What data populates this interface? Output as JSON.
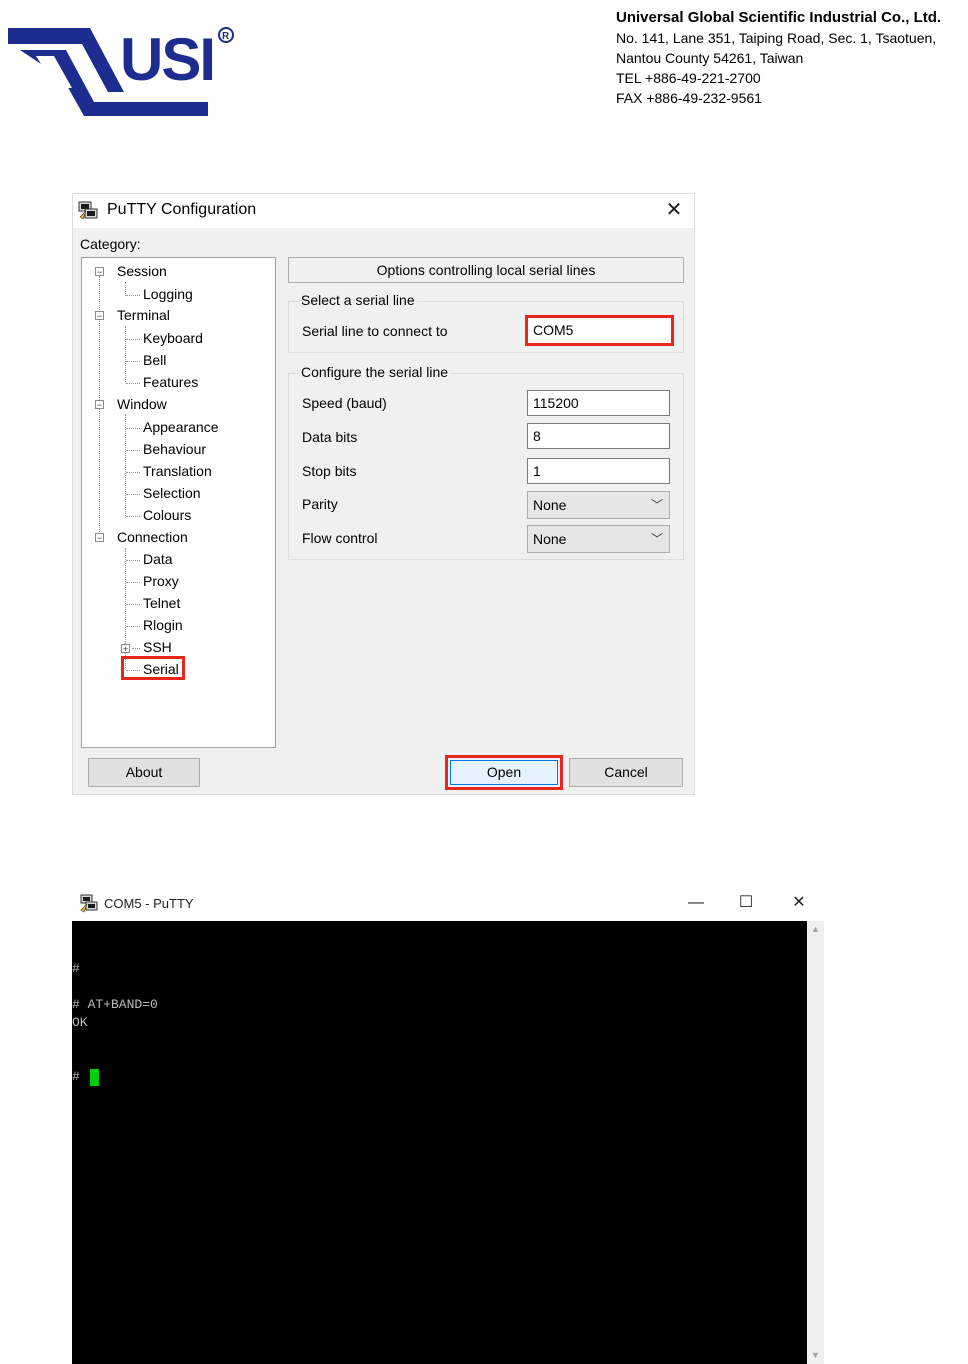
{
  "header": {
    "logo_text": "USI",
    "company_name": "Universal Global Scientific Industrial Co., Ltd.",
    "address_line1": "No. 141, Lane 351, Taiping Road, Sec. 1, Tsaotuen,",
    "address_line2": "Nantou County 54261, Taiwan",
    "tel": "TEL  +886-49-221-2700",
    "fax": "FAX +886-49-232-9561"
  },
  "config_dialog": {
    "title": "PuTTY Configuration",
    "category_label": "Category:",
    "tree": {
      "session": "Session",
      "logging": "Logging",
      "terminal": "Terminal",
      "keyboard": "Keyboard",
      "bell": "Bell",
      "features": "Features",
      "window": "Window",
      "appearance": "Appearance",
      "behaviour": "Behaviour",
      "translation": "Translation",
      "selection": "Selection",
      "colours": "Colours",
      "connection": "Connection",
      "data": "Data",
      "proxy": "Proxy",
      "telnet": "Telnet",
      "rlogin": "Rlogin",
      "ssh": "SSH",
      "serial": "Serial"
    },
    "panel_header": "Options controlling local serial lines",
    "select_group": {
      "label": "Select a serial line",
      "serial_line_label": "Serial line to connect to",
      "serial_line_value": "COM5"
    },
    "config_group": {
      "label": "Configure the serial line",
      "speed_label": "Speed (baud)",
      "speed_value": "115200",
      "data_bits_label": "Data bits",
      "data_bits_value": "8",
      "stop_bits_label": "Stop bits",
      "stop_bits_value": "1",
      "parity_label": "Parity",
      "parity_value": "None",
      "flow_label": "Flow control",
      "flow_value": "None"
    },
    "buttons": {
      "about": "About",
      "open": "Open",
      "cancel": "Cancel"
    },
    "highlight_color": "#e8261d"
  },
  "terminal_window": {
    "title": "COM5 - PuTTY",
    "lines": [
      "#",
      "# AT+BAND=0",
      "OK",
      "#"
    ],
    "cursor_color": "#00d000"
  }
}
